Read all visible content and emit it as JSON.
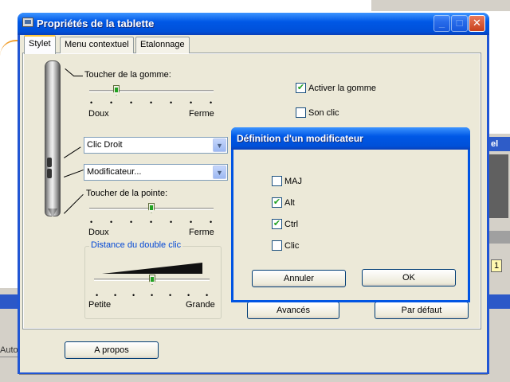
{
  "window": {
    "title": "Propriétés de la tablette",
    "min_label": "_",
    "max_label": "□",
    "close_label": "✕"
  },
  "tabs": [
    {
      "label": "Stylet",
      "active": true
    },
    {
      "label": "Menu contextuel",
      "active": false
    },
    {
      "label": "Etalonnage",
      "active": false
    }
  ],
  "eraser_feel": {
    "label": "Toucher de la gomme:",
    "min_label": "Doux",
    "max_label": "Ferme",
    "value_fraction": 0.2
  },
  "eraser_options": {
    "enable_eraser": {
      "label": "Activer la gomme",
      "checked": true
    },
    "click_sound": {
      "label": "Son clic",
      "checked": false
    }
  },
  "button_upper_combo": {
    "value": "Clic Droit"
  },
  "button_lower_combo": {
    "value": "Modificateur..."
  },
  "tip_feel": {
    "label": "Toucher de la pointe:",
    "min_label": "Doux",
    "max_label": "Ferme",
    "value_fraction": 0.5
  },
  "double_click": {
    "label": "Distance du double clic",
    "min_label": "Petite",
    "max_label": "Grande",
    "value_fraction": 0.5
  },
  "buttons": {
    "advanced": "Avancés",
    "default": "Par défaut",
    "about": "A propos"
  },
  "modifier_dialog": {
    "title": "Définition d'un modificateur",
    "options": [
      {
        "label": "MAJ",
        "checked": false
      },
      {
        "label": "Alt",
        "checked": true
      },
      {
        "label": "Ctrl",
        "checked": true
      },
      {
        "label": "Clic",
        "checked": false
      }
    ],
    "cancel_label": "Annuler",
    "ok_label": "OK"
  },
  "background": {
    "left_label": "Auto",
    "right_title": "el",
    "right_number": "1"
  },
  "glyphs": {
    "dropdown": "▼",
    "check": "✔",
    "tick_mark": "•"
  }
}
